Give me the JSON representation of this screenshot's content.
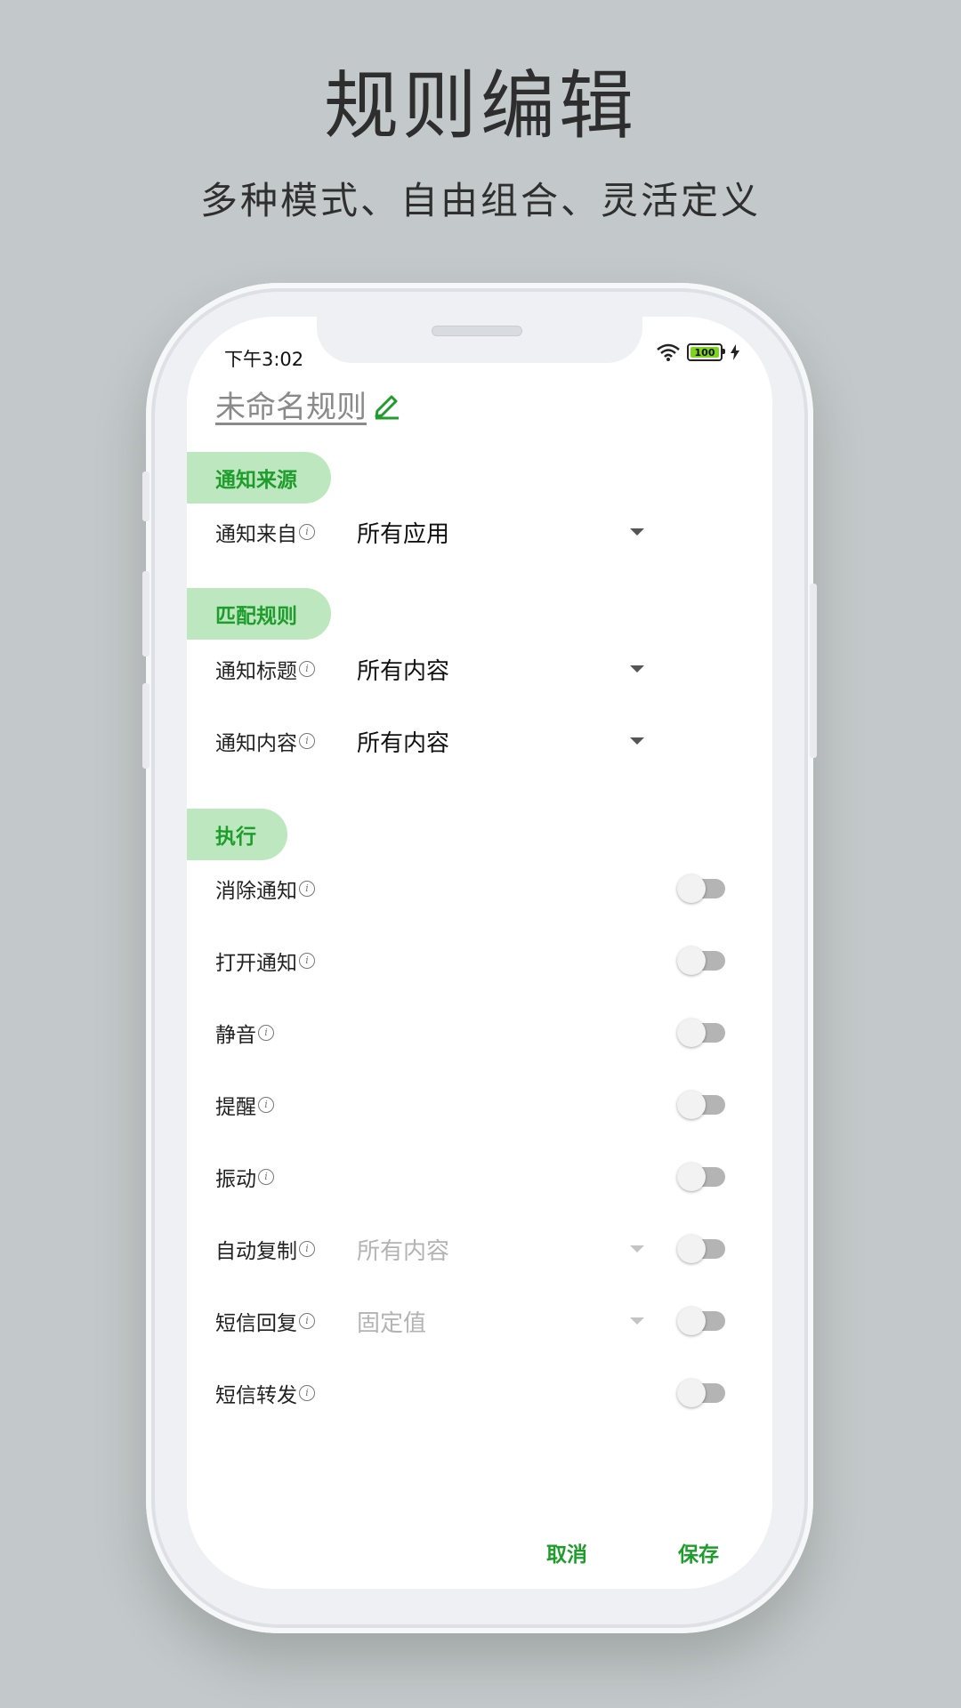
{
  "hero": {
    "title": "规则编辑",
    "subtitle": "多种模式、自由组合、灵活定义"
  },
  "status_bar": {
    "time": "下午3:02",
    "battery": "100"
  },
  "rule": {
    "name": "未命名规则"
  },
  "sections": {
    "source": {
      "title": "通知来源"
    },
    "match": {
      "title": "匹配规则"
    },
    "execute": {
      "title": "执行"
    }
  },
  "fields": {
    "notify_from": {
      "label": "通知来自",
      "value": "所有应用"
    },
    "notify_title": {
      "label": "通知标题",
      "value": "所有内容"
    },
    "notify_content": {
      "label": "通知内容",
      "value": "所有内容"
    }
  },
  "actions": [
    {
      "label": "消除通知",
      "enabled": false
    },
    {
      "label": "打开通知",
      "enabled": false
    },
    {
      "label": "静音",
      "enabled": false
    },
    {
      "label": "提醒",
      "enabled": false
    },
    {
      "label": "振动",
      "enabled": false
    },
    {
      "label": "自动复制",
      "value": "所有内容",
      "enabled": false
    },
    {
      "label": "短信回复",
      "value": "固定值",
      "enabled": false
    },
    {
      "label": "短信转发",
      "enabled": false
    }
  ],
  "buttons": {
    "cancel": "取消",
    "save": "保存"
  },
  "colors": {
    "accent": "#1f9d2c",
    "pill": "#bde8bf",
    "background": "#c3c9ca"
  },
  "icons": {
    "info": "info-icon",
    "caret": "caret-down-icon",
    "edit": "pencil-icon",
    "wifi": "wifi-icon",
    "battery": "battery-icon",
    "charging": "bolt-icon"
  }
}
